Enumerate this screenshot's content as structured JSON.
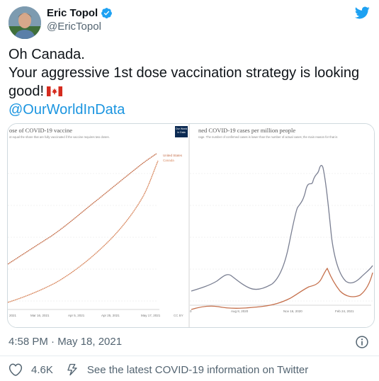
{
  "author": {
    "name": "Eric Topol",
    "handle": "@EricTopol"
  },
  "tweet": {
    "lines": [
      "Oh Canada.",
      "Your aggressive 1st dose vaccination strategy is looking",
      "good!"
    ],
    "mention": "@OurWorldInData"
  },
  "media": {
    "left_chart": {
      "title": "ose of COVID-19 vaccine",
      "subtitle": "ot equal the share that are fully vaccinated if the vaccine requires two doses.",
      "x_ticks": [
        "2021",
        "Mar 16, 2021",
        "Apr 5, 2021",
        "Apr 25, 2021",
        "May 17, 2021"
      ],
      "legend": [
        "United States",
        "Canada"
      ],
      "colors": {
        "us": "#c5704c",
        "canada": "#d98960"
      }
    },
    "right_chart": {
      "logo_text": "Our World in Data",
      "title": "ned COVID-19 cases per million people",
      "subtitle": "rage. The number of confirmed cases is lower than the number of actual cases; the main reason for that is",
      "x_ticks": [
        "0",
        "Aug 8, 2020",
        "Nov 16, 2020",
        "Feb 24, 2021"
      ],
      "footer": "CC BY",
      "colors": {
        "us": "#7a7f92",
        "canada": "#c5704c"
      }
    }
  },
  "meta": {
    "timestamp": "4:58 PM · May 18, 2021"
  },
  "actions": {
    "likes": "4.6K",
    "covid_info": "See the latest COVID-19 information on Twitter"
  },
  "colors": {
    "link": "#1b95e0",
    "verified": "#1da1f2",
    "twitter_bird": "#1da1f2"
  },
  "icons": [
    "verified-badge-icon",
    "twitter-bird-icon",
    "canada-flag-icon",
    "info-icon",
    "heart-icon",
    "lightning-icon"
  ]
}
